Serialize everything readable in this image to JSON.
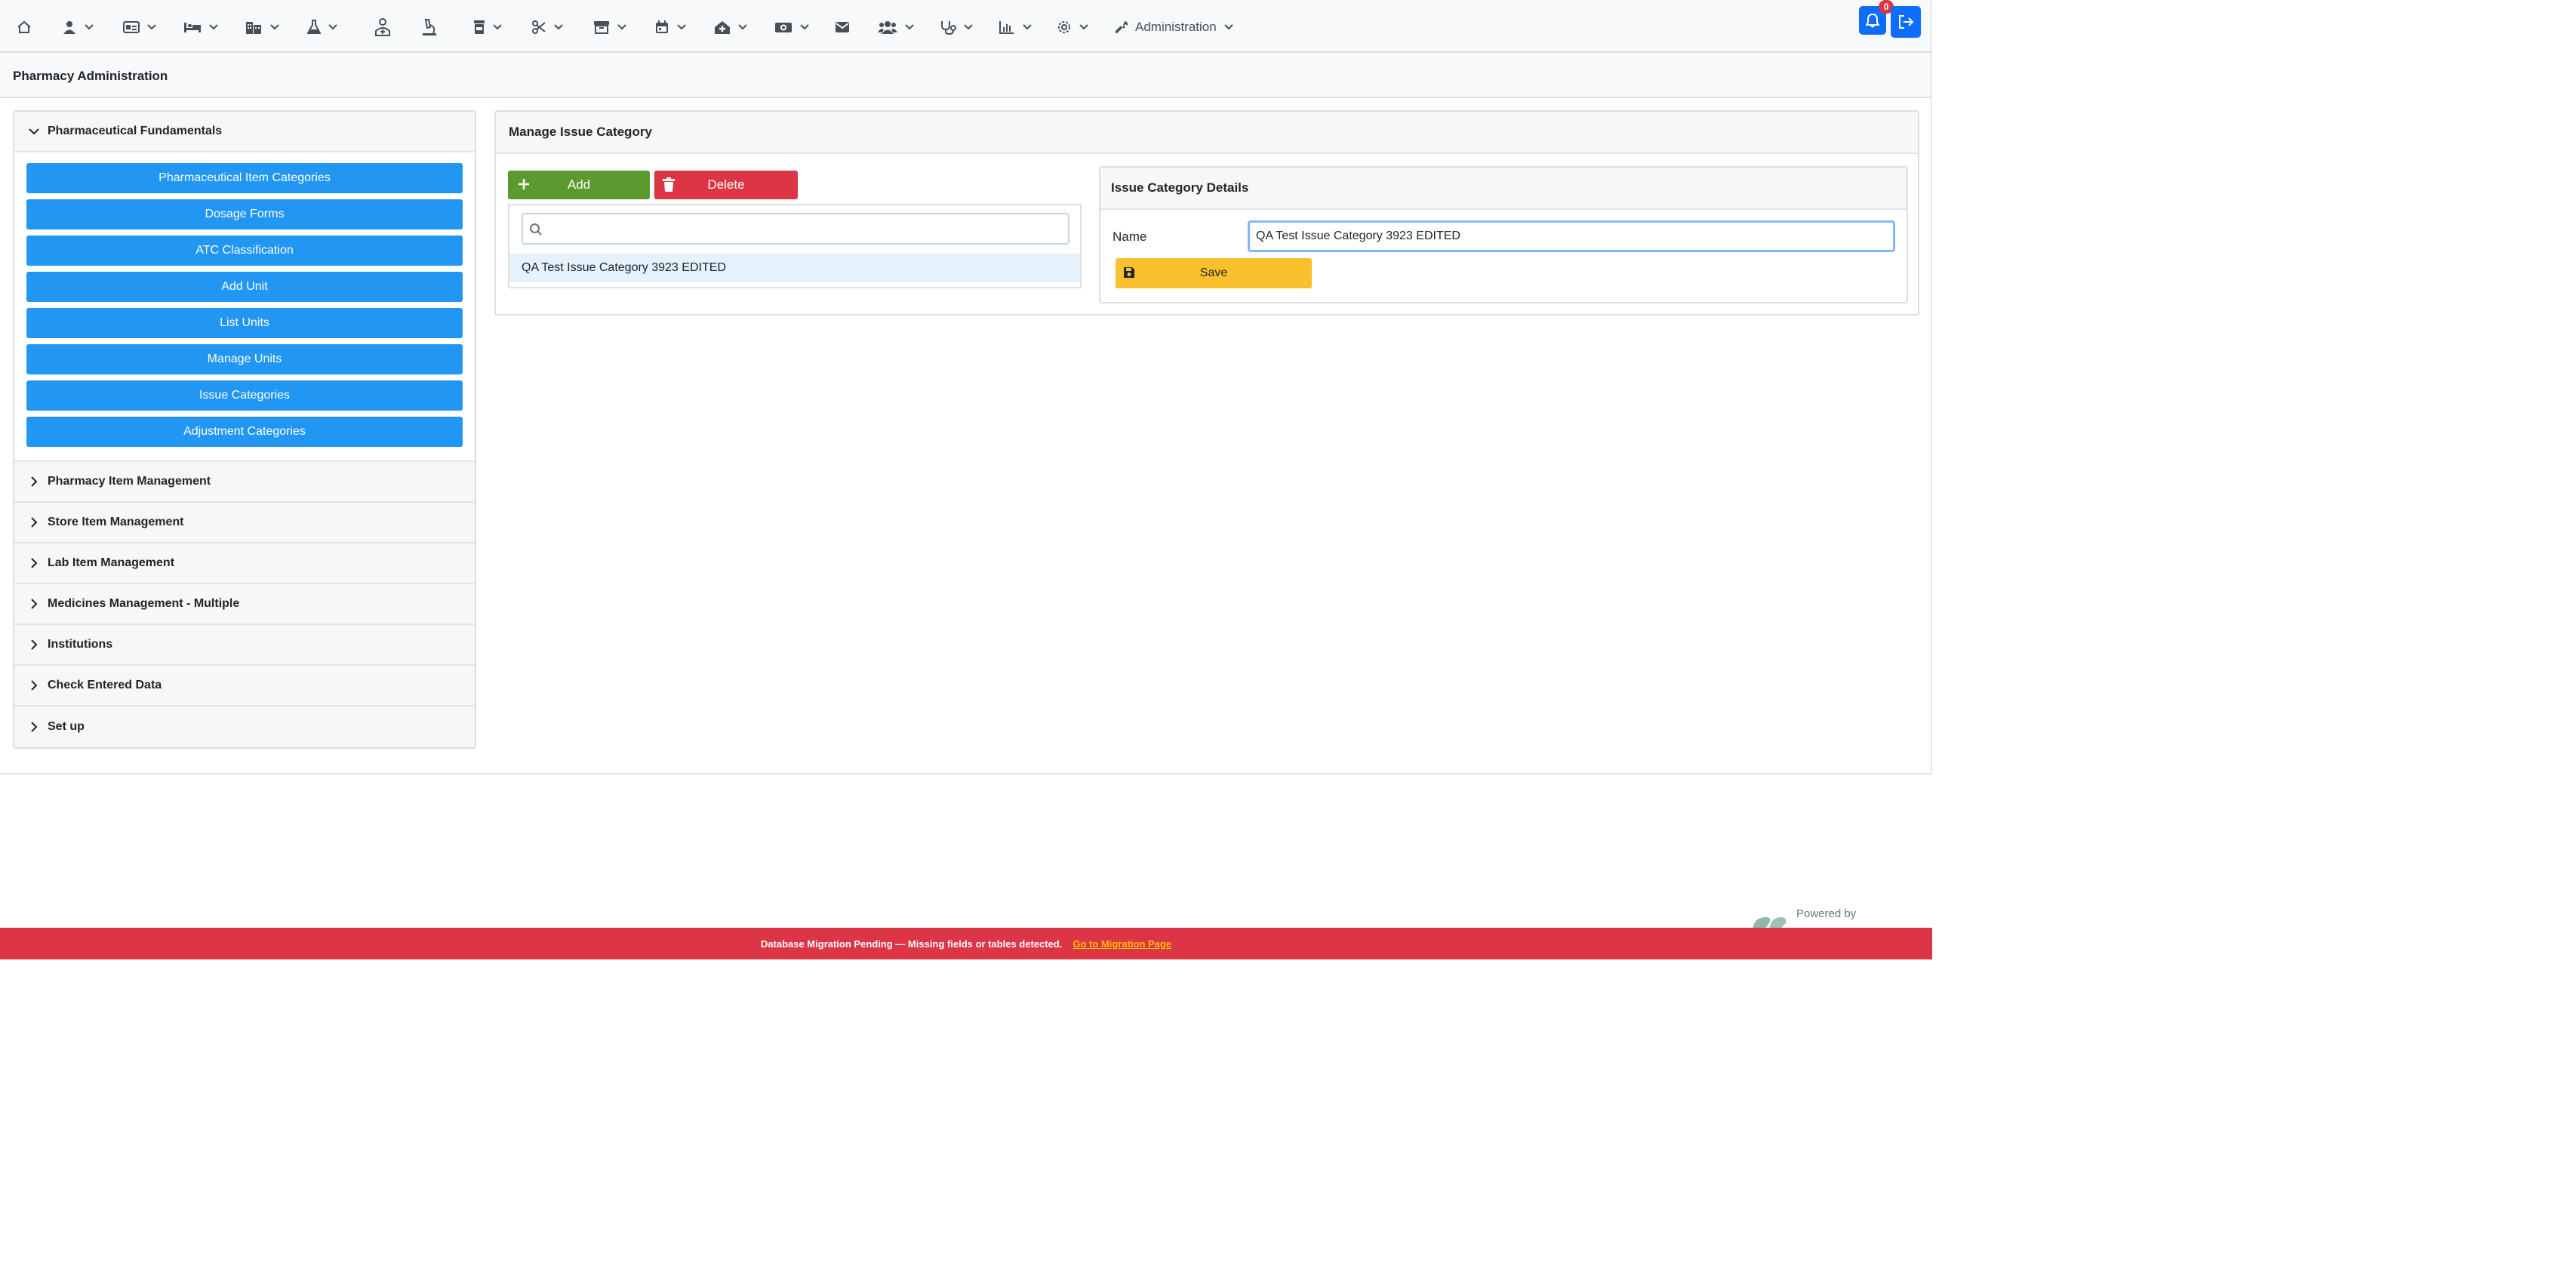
{
  "navbar": {
    "icons": [
      "home-icon",
      "user-doctor-icon",
      "id-card-icon",
      "bed-icon",
      "building-icon",
      "flask-icon",
      "person-medical-icon",
      "microscope-icon",
      "pill-bottle-icon",
      "scissors-icon",
      "warehouse-icon",
      "calendar-icon",
      "house-medical-icon",
      "money-icon",
      "envelope-icon",
      "users-icon",
      "stethoscope-icon",
      "chart-icon",
      "gear-icon",
      "wrench-icon"
    ],
    "admin_label": "Administration",
    "notification_count": "0"
  },
  "page": {
    "title": "Pharmacy Administration"
  },
  "sidebar": {
    "open_section": {
      "title": "Pharmaceutical Fundamentals",
      "items": [
        {
          "label": "Pharmaceutical Item Categories"
        },
        {
          "label": "Dosage Forms"
        },
        {
          "label": "ATC Classification"
        },
        {
          "label": "Add Unit"
        },
        {
          "label": "List Units"
        },
        {
          "label": "Manage Units"
        },
        {
          "label": "Issue Categories"
        },
        {
          "label": "Adjustment Categories"
        }
      ]
    },
    "sections": [
      {
        "label": "Pharmacy Item Management"
      },
      {
        "label": "Store Item Management"
      },
      {
        "label": "Lab Item Management"
      },
      {
        "label": "Medicines Management - Multiple"
      },
      {
        "label": "Institutions"
      },
      {
        "label": "Check Entered Data"
      },
      {
        "label": "Set up"
      }
    ]
  },
  "manage": {
    "title": "Manage Issue Category",
    "add_label": "Add",
    "delete_label": "Delete",
    "search": {
      "value": "",
      "placeholder": ""
    },
    "list": [
      {
        "label": "QA Test Issue Category 3923 EDITED"
      }
    ],
    "details": {
      "title": "Issue Category Details",
      "name_label": "Name",
      "name_value": "QA Test Issue Category 3923 EDITED",
      "save_label": "Save"
    }
  },
  "footer": {
    "powered_by": "Powered by",
    "migration_message": "Database Migration Pending — Missing fields or tables detected.",
    "migration_link": "Go to Migration Page"
  },
  "colors": {
    "primary": "#2196f3",
    "add": "#5a9a2e",
    "delete": "#dc3545",
    "save": "#fbc02d",
    "banner": "#dc3545",
    "banner_link": "#ffc107"
  }
}
